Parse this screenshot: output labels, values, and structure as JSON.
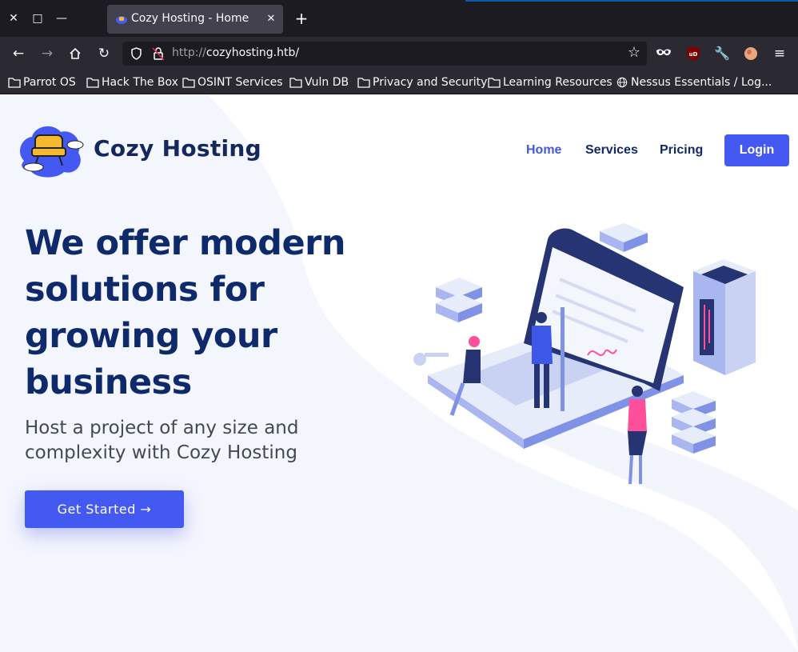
{
  "browser": {
    "tab_title": "Cozy Hosting - Home",
    "url_scheme": "http://",
    "url_host": "cozyhosting.htb/",
    "bookmarks": [
      "Parrot OS",
      "Hack The Box",
      "OSINT Services",
      "Vuln DB",
      "Privacy and Security",
      "Learning Resources",
      "Nessus Essentials / Log..."
    ]
  },
  "site": {
    "brand": "Cozy Hosting",
    "nav": {
      "home": "Home",
      "services": "Services",
      "pricing": "Pricing",
      "login": "Login"
    },
    "hero": {
      "title": "We offer modern solutions for growing your business",
      "subtitle": "Host a project of any size and complexity with Cozy Hosting",
      "cta": "Get Started →"
    }
  },
  "colors": {
    "accent": "#4458f2",
    "heading": "#0f2a6b",
    "chrome_dark": "#1c1b22",
    "chrome_mid": "#2b2a33"
  },
  "icons": [
    "close-icon",
    "maximize-icon",
    "minimize-icon",
    "back-icon",
    "forward-icon",
    "home-icon",
    "reload-icon",
    "shield-icon",
    "insecure-lock-icon",
    "star-icon",
    "mask-icon",
    "ublock-icon",
    "wrench-icon",
    "profile-icon",
    "menu-icon",
    "folder-icon",
    "globe-icon",
    "arrow-right-icon"
  ]
}
